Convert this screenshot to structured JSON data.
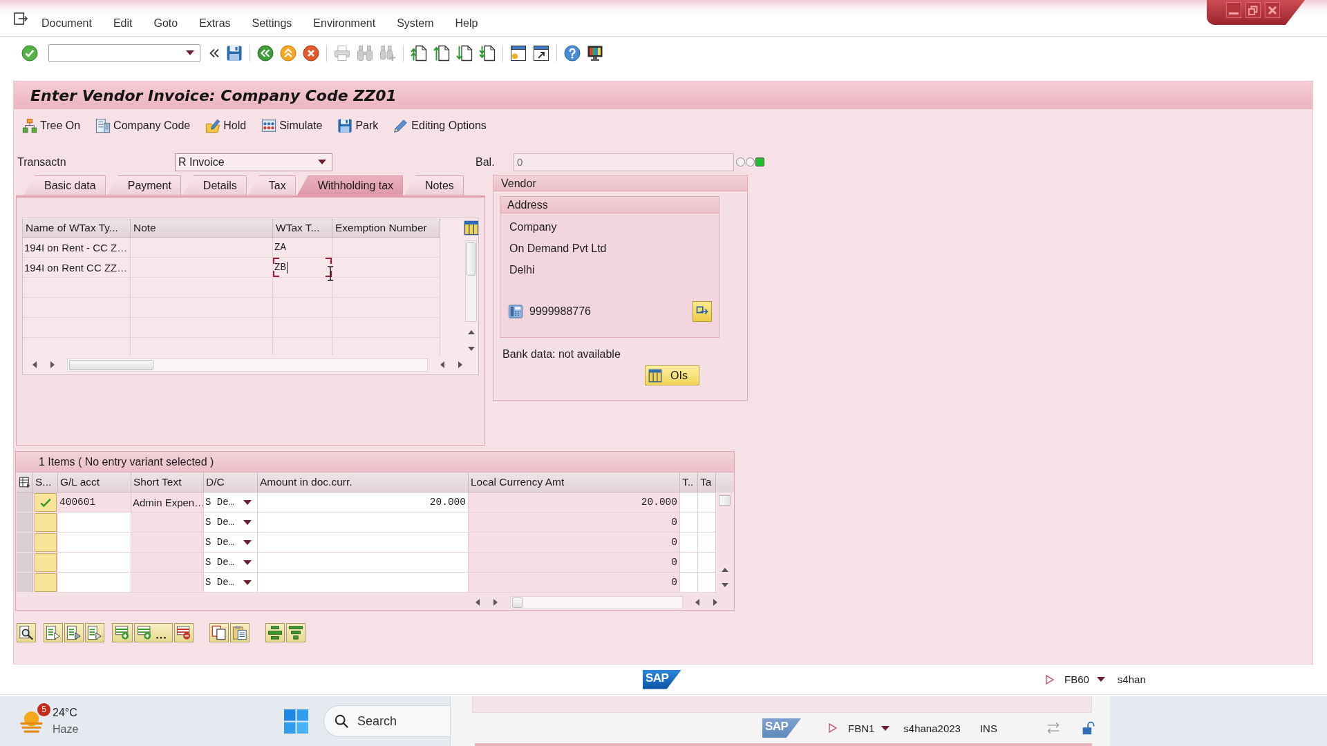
{
  "menu": [
    "Document",
    "Edit",
    "Goto",
    "Extras",
    "Settings",
    "Environment",
    "System",
    "Help"
  ],
  "standard_toolbar": {
    "buttons": [
      {
        "disabled": false
      },
      {
        "disabled": false
      },
      {
        "disabled": false
      },
      {
        "disabled": false
      },
      {
        "disabled": false
      },
      {
        "disabled": false
      },
      {
        "disabled": true
      },
      {
        "disabled": true
      },
      {
        "disabled": true
      },
      {
        "disabled": false
      },
      {
        "disabled": false
      },
      {
        "disabled": false
      },
      {
        "disabled": false
      },
      {
        "disabled": false
      },
      {
        "disabled": false
      },
      {
        "disabled": false
      },
      {
        "disabled": false
      }
    ]
  },
  "title": "Enter Vendor Invoice: Company Code ZZ01",
  "app_toolbar": [
    "Tree On",
    "Company Code",
    "Hold",
    "Simulate",
    "Park",
    "Editing Options"
  ],
  "header": {
    "transaction": {
      "label": "Transactn",
      "value": "R Invoice"
    },
    "balance": {
      "label": "Bal.",
      "value": "0",
      "lights": [
        {
          "on": false
        },
        {
          "on": false
        },
        {
          "on": true
        }
      ]
    }
  },
  "tabs": [
    {
      "label": "Basic data",
      "selected": false
    },
    {
      "label": "Payment",
      "selected": false
    },
    {
      "label": "Details",
      "selected": false
    },
    {
      "label": "Tax",
      "selected": false
    },
    {
      "label": "Withholding tax",
      "selected": true
    },
    {
      "label": "Notes",
      "selected": false
    }
  ],
  "withholding_tax_table": {
    "columns": [
      "Name of WTax Ty...",
      "Note",
      "WTax T...",
      "Exemption Number"
    ],
    "rows": [
      {
        "column_1": "194I on Rent - CC Z…",
        "column_3": "ZA",
        "focused": false
      },
      {
        "column_1": "194I on Rent CC ZZ…",
        "column_3": "ZB",
        "focused": true
      }
    ]
  },
  "vendor": {
    "title": "Vendor",
    "address": {
      "title": "Address",
      "lines": [
        "Company",
        "On Demand Pvt Ltd",
        "Delhi"
      ],
      "phone": "9999988776"
    },
    "bank_data": "Bank data: not available",
    "open_items_button": "OIs"
  },
  "items": {
    "title": "1 Items ( No entry variant selected )",
    "columns": [
      "S...",
      "G/L acct",
      "Short Text",
      "D/C",
      "Amount in doc.curr.",
      "Local Currency Amt",
      "T..",
      "Ta"
    ],
    "rows": [
      {
        "checked": true,
        "gl_acct": "400601",
        "short_text": "Admin Expen…",
        "dc": "S De…",
        "amount": "20.000",
        "local_amount": "20.000"
      },
      {
        "checked": false,
        "dc": "S De…",
        "local_amount": "0"
      },
      {
        "checked": false,
        "dc": "S De…",
        "local_amount": "0"
      },
      {
        "checked": false,
        "dc": "S De…",
        "local_amount": "0"
      },
      {
        "checked": false,
        "dc": "S De…",
        "local_amount": "0"
      }
    ]
  },
  "status_bar": {
    "logo": "SAP",
    "transaction": "FB60",
    "system": "s4han"
  },
  "taskbar": {
    "weather": {
      "badge": "5",
      "temperature": "24°C",
      "condition": "Haze"
    },
    "search": {
      "label": "Search"
    },
    "window_preview": {
      "logo": "SAP",
      "transaction": "FBN1",
      "system": "s4hana2023",
      "mode": "INS"
    }
  }
}
